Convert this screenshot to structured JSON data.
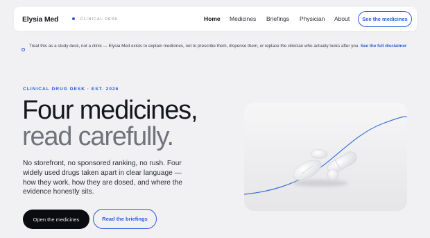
{
  "nav": {
    "brand": "Elysia Med",
    "brand_sub": "CLINICAL DESK",
    "links": [
      "Home",
      "Medicines",
      "Briefings",
      "Physician",
      "About"
    ],
    "cta": "See the medicines"
  },
  "notice": {
    "text": "Treat this as a study desk, not a clinic — Elysia Med exists to explain medicines, not to prescribe them, dispense them, or replace the clinician who actually looks after you.",
    "link": "See the full disclaimer"
  },
  "hero": {
    "eyebrow": "CLINICAL DRUG DESK · EST. 2026",
    "title_line1": "Four medicines,",
    "title_line2": "read carefully.",
    "lede": "No storefront, no sponsored ranking, no rush. Four widely used drugs taken apart in clear language — how they work, how they are dosed, and where the evidence honestly sits.",
    "primary_button": "Open the medicines",
    "secondary_button": "Read the briefings"
  },
  "colors": {
    "accent": "#2a5bd7",
    "background": "#f1f1f3",
    "ink": "#16181d"
  }
}
